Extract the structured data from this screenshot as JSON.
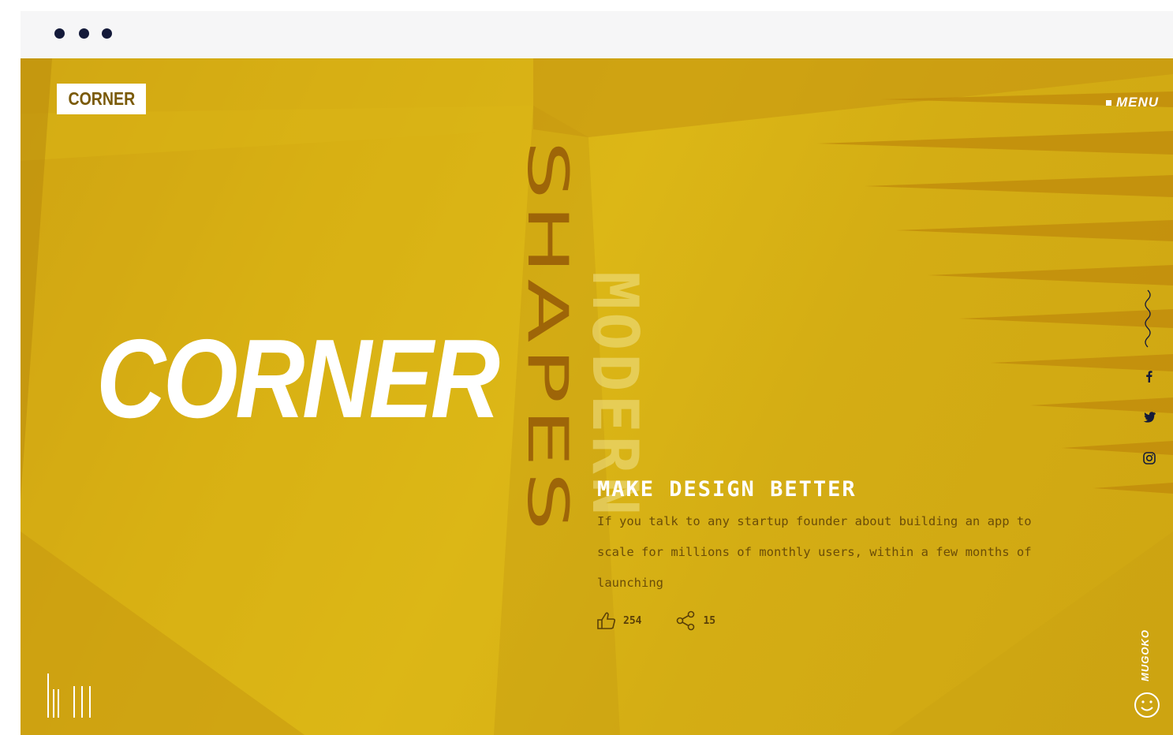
{
  "browser": {
    "dots": [
      "dot",
      "dot",
      "dot"
    ]
  },
  "header": {
    "logo": "CORNER",
    "menu_label": "MENU"
  },
  "hero": {
    "title": "CORNER",
    "vertical_title": "SHAPES",
    "vertical_subtitle": "MODERN",
    "headline": "MAKE DESIGN BETTER",
    "description": "If you talk to any startup founder about building an app to scale for millions of monthly users, within a few months of launching",
    "likes": "254",
    "shares": "15"
  },
  "social": [
    "facebook-icon",
    "twitter-icon",
    "instagram-icon"
  ],
  "footer": {
    "brand": "MUGOKO"
  },
  "colors": {
    "accent": "#d4ac13",
    "dark": "#141a3a",
    "brown": "#9e6508"
  }
}
